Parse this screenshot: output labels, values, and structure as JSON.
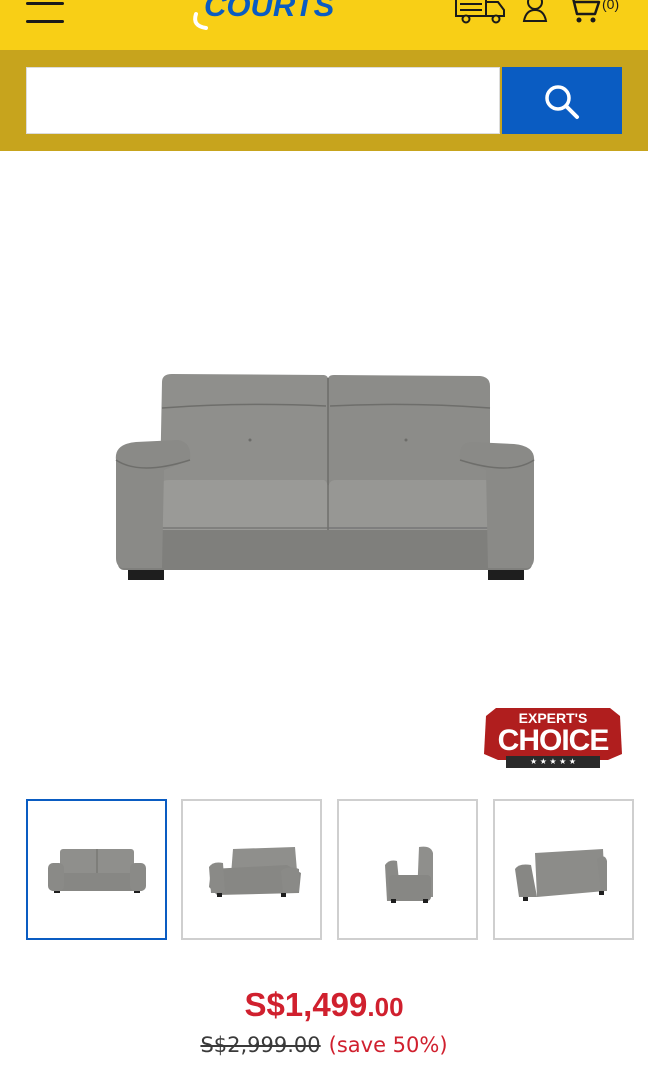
{
  "header": {
    "brand": "COURTS",
    "cart_count": "(0)",
    "icons": [
      "menu-icon",
      "delivery-truck-icon",
      "user-icon",
      "cart-icon"
    ]
  },
  "search": {
    "placeholder": "",
    "button_icon": "search-icon"
  },
  "product": {
    "badge_top": "EXPERT'S",
    "badge_main": "CHOICE",
    "badge_stars": "★ ★ ★ ★ ★",
    "price_main": "S$1,499",
    "price_cents": ".00",
    "price_old": "S$2,999.00",
    "price_save": "(save 50%)",
    "thumbnails": [
      "sofa-front-view",
      "sofa-angle-view",
      "sofa-side-view",
      "sofa-back-view"
    ]
  },
  "colors": {
    "header_yellow": "#f8cf16",
    "search_band": "#c7a41d",
    "brand_blue": "#0a5cc2",
    "price_red": "#d0202e",
    "sofa_grey": "#8e8e8b"
  }
}
